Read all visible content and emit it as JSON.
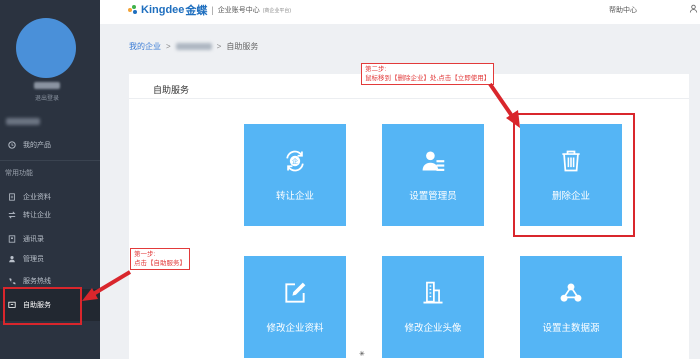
{
  "header": {
    "logo_en": "Kingdee",
    "logo_cn": "金蝶",
    "center_title": "企业账号中心",
    "center_sub": "(商企业平台)",
    "help": "帮助中心",
    "user_icon": "user-icon"
  },
  "sidebar": {
    "user_sub": "退出登录",
    "my_products": "我的产品",
    "common_label": "常用功能",
    "items": [
      {
        "label": "企业资料",
        "icon": "document-icon"
      },
      {
        "label": "转让企业",
        "icon": "transfer-icon"
      },
      {
        "label": "通讯录",
        "icon": "contacts-icon"
      },
      {
        "label": "管理员",
        "icon": "admin-icon"
      },
      {
        "label": "服务热线",
        "icon": "phone-icon"
      },
      {
        "label": "自助服务",
        "icon": "self-service-icon"
      }
    ]
  },
  "breadcrumb": {
    "root": "我的企业",
    "sep": ">",
    "current": "自助服务"
  },
  "panel": {
    "title": "自助服务",
    "tiles": [
      {
        "label": "转让企业",
        "icon": "transfer-company-icon"
      },
      {
        "label": "设置管理员",
        "icon": "set-admin-icon"
      },
      {
        "label": "删除企业",
        "icon": "trash-icon"
      },
      {
        "label": "修改企业资料",
        "icon": "edit-icon"
      },
      {
        "label": "修改企业头像",
        "icon": "building-icon"
      },
      {
        "label": "设置主数据源",
        "icon": "data-source-icon"
      }
    ]
  },
  "annotations": {
    "step1_title": "第一步:",
    "step1_text": "点击【自助服务】",
    "step2_title": "第二步:",
    "step2_text": "鼠标移到【删除企业】处,点击【立即使用】"
  },
  "colors": {
    "sidebar_bg": "#2b3340",
    "tile_blue": "#55b5f5",
    "annotation_red": "#e23a3a",
    "brand_blue": "#1f6fbf"
  }
}
